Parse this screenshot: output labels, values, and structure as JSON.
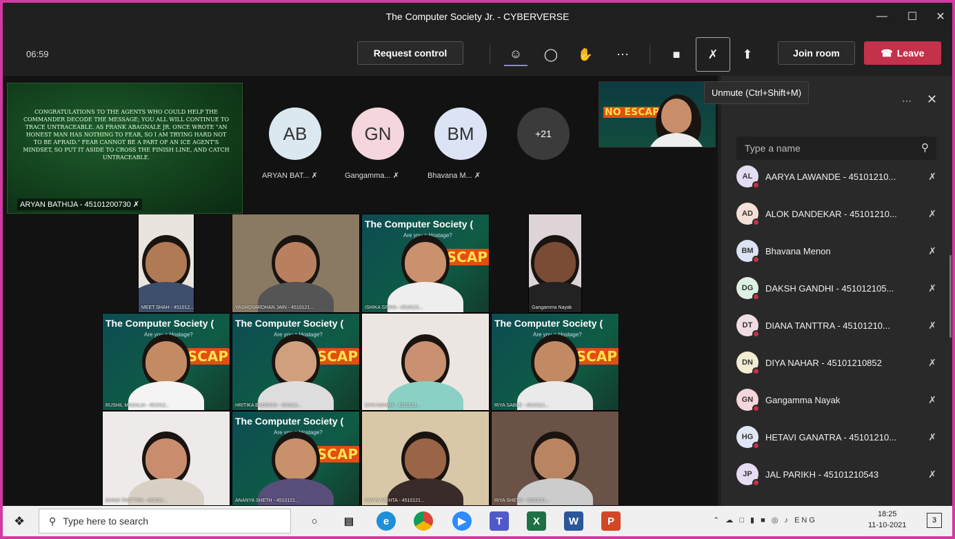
{
  "window": {
    "title": "The Computer Society Jr. - CYBERVERSE"
  },
  "toolbar": {
    "timer": "06:59",
    "request_control": "Request control",
    "join_room": "Join room",
    "leave": "Leave",
    "tooltip": "Unmute (Ctrl+Shift+M)",
    "icons": [
      "participants-icon",
      "chat-icon",
      "raise-hand-icon",
      "more-icon",
      "camera-icon",
      "mic-off-icon",
      "share-icon"
    ]
  },
  "stage": {
    "shared_text": "Congratulations to the agents who could help the commander decode the message; you all will continue to trace Untraceable. As Frank Abagnale Jr. once wrote \"An honest man has nothing to fear, so I am trying hard not to be afraid.\" Fear cannot be a part of an ice agent's mindset, so put it aside to cross the finish line, and catch Untraceable.",
    "shared_name": "ARYAN BATHIJA - 45101200730",
    "avatars": [
      {
        "initials": "AB",
        "name": "ARYAN BAT...",
        "color": "#dce8f0"
      },
      {
        "initials": "GN",
        "name": "Gangamma...",
        "color": "#f5d6dc"
      },
      {
        "initials": "BM",
        "name": "Bhavana M...",
        "color": "#dce3f5"
      }
    ],
    "overflow": "+21",
    "brand_title": "The Computer Society (",
    "brand_sub": "Are you a Hostage?",
    "brand_escape": "NO ESCAP",
    "tiles": [
      "MEET SHAH - 451012...",
      "YASHOVARDHAN JAIN - 4510121...",
      "ISHIKA SINHA - 4510121...",
      "Gangamma Nayak",
      "RUSHIL MASALIA - 451012...",
      "HRITIKA BAGRANI - 451012...",
      "DIYA NAHAR - 4510121...",
      "RIYA SABLE - 4510121...",
      "DIANA TANTTRA - 451012...",
      "ANANYA SHETH - 4510121...",
      "KAVYA MEHTA - 4510121...",
      "RIYA SHETH - 4510121..."
    ]
  },
  "panel": {
    "search_placeholder": "Type a name",
    "participants": [
      {
        "initials": "AL",
        "name": "AARYA LAWANDE - 45101210...",
        "color": "#e3ddf3"
      },
      {
        "initials": "AD",
        "name": "ALOK DANDEKAR - 45101210...",
        "color": "#f5e0d8"
      },
      {
        "initials": "BM",
        "name": "Bhavana Menon",
        "color": "#dce3f5"
      },
      {
        "initials": "DG",
        "name": "DAKSH GANDHI - 451012105...",
        "color": "#dcf0e3"
      },
      {
        "initials": "DT",
        "name": "DIANA TANTTRA - 45101210...",
        "color": "#f0dce3"
      },
      {
        "initials": "DN",
        "name": "DIYA NAHAR - 45101210852",
        "color": "#f3ecd3"
      },
      {
        "initials": "GN",
        "name": "Gangamma Nayak",
        "color": "#f5d6dc"
      },
      {
        "initials": "HG",
        "name": "HETAVI GANATRA - 45101210...",
        "color": "#e0e6f5"
      },
      {
        "initials": "JP",
        "name": "JAL PARIKH - 45101210543",
        "color": "#e6ddf3"
      }
    ]
  },
  "taskbar": {
    "search": "Type here to search",
    "lang": "ENG",
    "time": "18:25",
    "date": "11-10-2021",
    "notifications": "3"
  }
}
